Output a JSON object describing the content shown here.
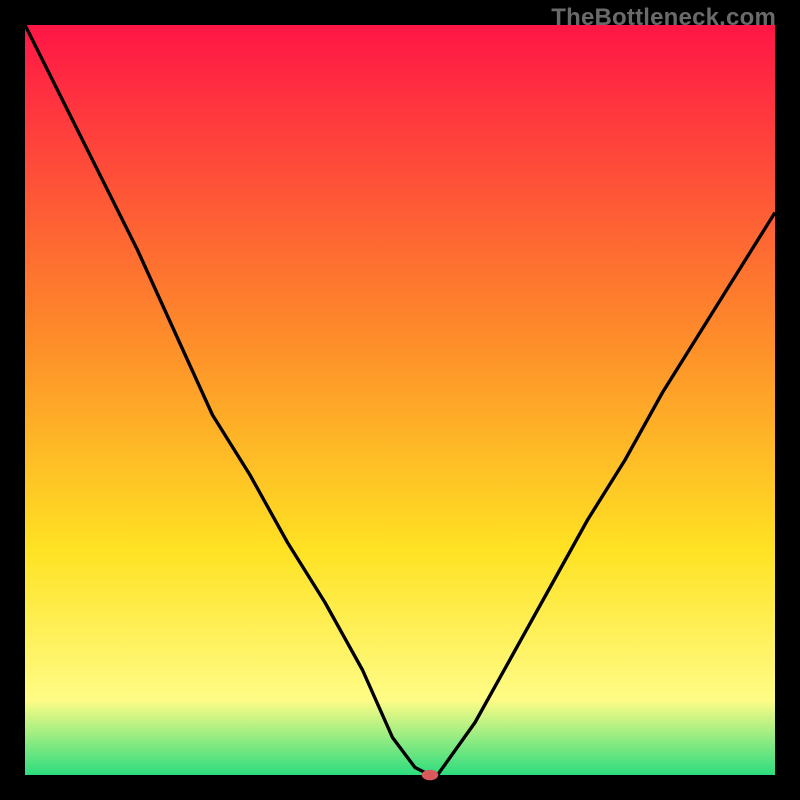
{
  "watermark": {
    "text": "TheBottleneck.com"
  },
  "gradient": {
    "top": "#ff1646",
    "upper": "#fe8d2a",
    "mid": "#ffe223",
    "lower": "#fffc86",
    "bottom": "#2cdc7e"
  },
  "chart_data": {
    "type": "line",
    "title": "",
    "xlabel": "",
    "ylabel": "",
    "xlim": [
      0,
      100
    ],
    "ylim": [
      0,
      100
    ],
    "x": [
      0,
      5,
      10,
      15,
      20,
      25,
      30,
      35,
      40,
      45,
      49,
      52,
      54,
      55,
      60,
      65,
      70,
      75,
      80,
      85,
      90,
      95,
      100
    ],
    "values": [
      100,
      90,
      80,
      70,
      59,
      48,
      40,
      31,
      23,
      14,
      5,
      1,
      0,
      0,
      7,
      16,
      25,
      34,
      42,
      51,
      59,
      67,
      75
    ],
    "minimum_marker": {
      "x": 54,
      "y": 0
    }
  }
}
